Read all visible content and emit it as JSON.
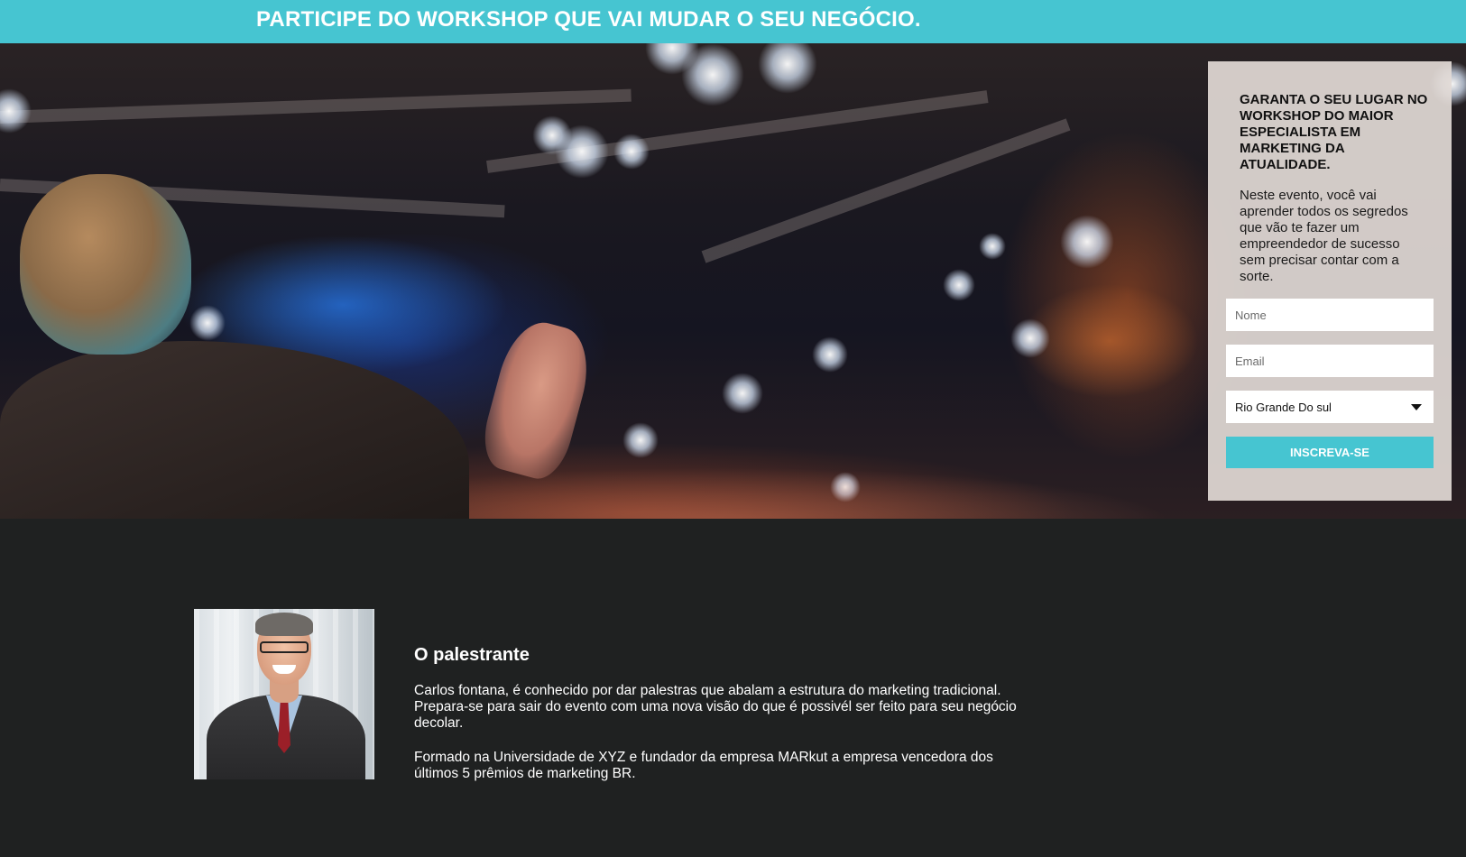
{
  "top_banner": {
    "headline": "PARTICIPE DO WORKSHOP QUE VAI MUDAR O SEU NEGÓCIO."
  },
  "signup_form": {
    "heading": "GARANTA O SEU LUGAR NO WORKSHOP DO MAIOR ESPECIALISTA EM MARKETING DA ATUALIDADE.",
    "description": "Neste evento, você vai aprender todos os segredos que vão te fazer um empreendedor de sucesso sem precisar contar com a sorte.",
    "name_placeholder": "Nome",
    "email_placeholder": "Email",
    "state_selected": "Rio Grande Do sul",
    "submit_label": "INSCREVA-SE"
  },
  "speaker": {
    "title": "O palestrante",
    "bio_paragraph_1": "Carlos fontana, é conhecido por dar palestras que abalam a estrutura do marketing tradicional. Prepara-se para sair do evento com uma nova visão do que é possivél ser feito para seu negócio decolar.",
    "bio_paragraph_2": "Formado na Universidade de XYZ e fundador da empresa MARkut a empresa vencedora dos últimos 5 prêmios de marketing BR."
  },
  "colors": {
    "accent": "#46c5d1",
    "dark_background": "#1f2121",
    "form_card": "#e2dad6"
  }
}
